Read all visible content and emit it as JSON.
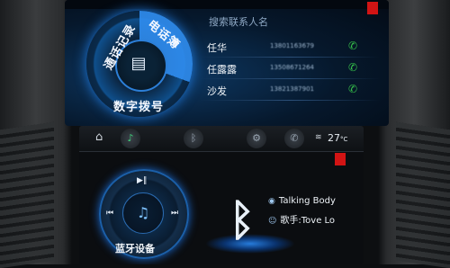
{
  "top_screen": {
    "dial": {
      "label_call_log": "通话记录",
      "label_contacts": "电话簿",
      "label_dialpad": "数字拨号",
      "center_icon": "contact-card-icon"
    },
    "search_placeholder": "搜索联系人名",
    "contacts": [
      {
        "name": "任华",
        "number": "13801163679"
      },
      {
        "name": "任露露",
        "number": "13508671264"
      },
      {
        "name": "沙发",
        "number": "13821387901"
      }
    ]
  },
  "bottom_screen": {
    "temperature": "27",
    "temp_unit": "°C",
    "nav_icons": [
      "home-icon",
      "music-icon",
      "bluetooth-icon",
      "car-settings-icon",
      "phone-icon"
    ],
    "bluetooth_label": "蓝牙设备",
    "controls": {
      "play_pause": "▶‖",
      "prev": "⏮",
      "next": "⏭",
      "center": "♫"
    },
    "track_title": "Talking Body",
    "artist": "歌手:Tove Lo"
  },
  "colors": {
    "accent": "#2f8df0",
    "call_green": "#36c24a",
    "alert_red": "#d21414"
  }
}
